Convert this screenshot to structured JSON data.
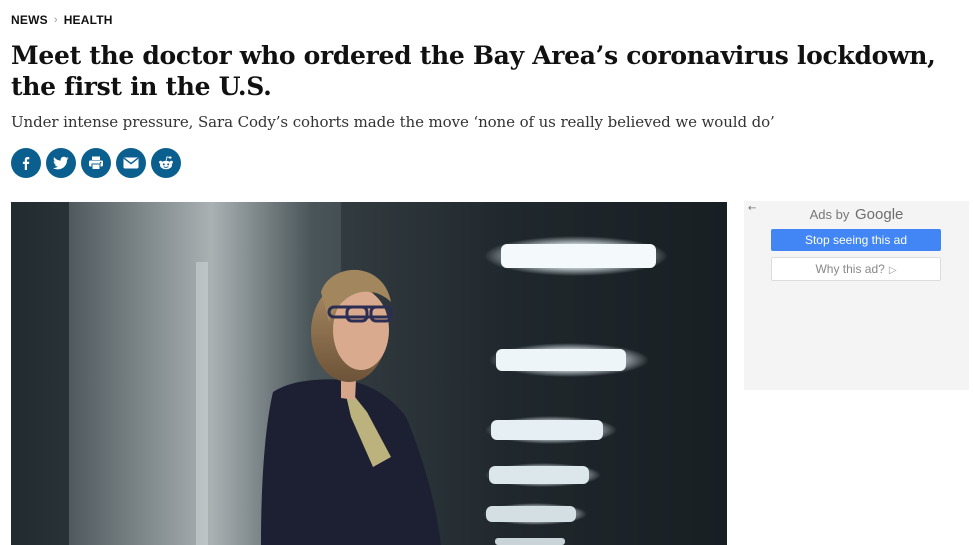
{
  "breadcrumb": {
    "section": "NEWS",
    "subsection": "HEALTH"
  },
  "article": {
    "headline": "Meet the doctor who ordered the Bay Area’s coronavirus lockdown, the first in the U.S.",
    "dek": "Under intense pressure, Sara Cody’s cohorts made the move ‘none of us really believed we would do’"
  },
  "share": {
    "buttons": [
      {
        "name": "facebook-icon",
        "glyph": "f"
      },
      {
        "name": "twitter-icon",
        "glyph": "twitter"
      },
      {
        "name": "print-icon",
        "glyph": "print"
      },
      {
        "name": "email-icon",
        "glyph": "email"
      },
      {
        "name": "reddit-icon",
        "glyph": "reddit"
      }
    ],
    "color": "#0b5f8f"
  },
  "ad": {
    "back_glyph": "←",
    "ads_by": "Ads by",
    "brand": "Google",
    "stop_label": "Stop seeing this ad",
    "why_label": "Why this ad?",
    "why_glyph": "▷",
    "accent": "#4285f4"
  }
}
